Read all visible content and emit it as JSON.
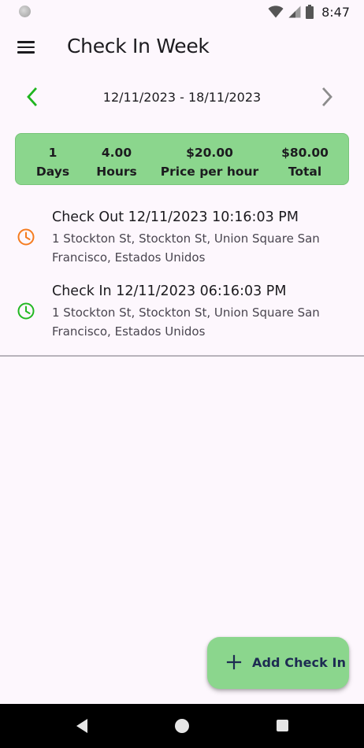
{
  "status_bar": {
    "time": "8:47"
  },
  "app_bar": {
    "title": "Check In Week"
  },
  "week_nav": {
    "range": "12/11/2023 - 18/11/2023"
  },
  "summary": {
    "days": {
      "value": "1",
      "label": "Days"
    },
    "hours": {
      "value": "4.00",
      "label": "Hours"
    },
    "price": {
      "value": "$20.00",
      "label": "Price per hour"
    },
    "total": {
      "value": "$80.00",
      "label": "Total"
    }
  },
  "entries": [
    {
      "title": "Check Out 12/11/2023 10:16:03 PM",
      "address": "1 Stockton St, Stockton St, Union Square San Francisco, Estados Unidos",
      "icon": "clock-icon",
      "color": "#f57c1f"
    },
    {
      "title": "Check In 12/11/2023 06:16:03 PM",
      "address": "1 Stockton St, Stockton St, Union Square San Francisco, Estados Unidos",
      "icon": "clock-icon",
      "color": "#22b822"
    }
  ],
  "fab": {
    "label": "Add Check In",
    "icon": "plus-icon"
  },
  "colors": {
    "accent_green": "#8bd68d",
    "nav_prev_green": "#1fb51f",
    "check_out_orange": "#f57c1f",
    "check_in_green": "#22b822",
    "background": "#fdf7fd"
  }
}
